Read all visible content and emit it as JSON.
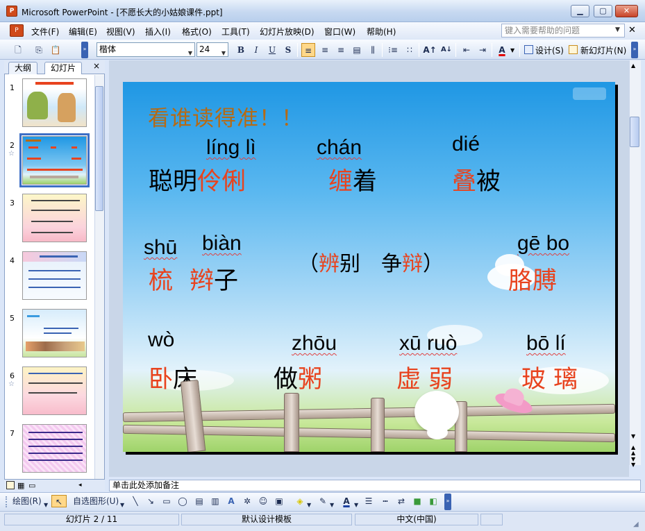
{
  "window": {
    "title": "Microsoft PowerPoint - [不愿长大的小姑娘课件.ppt]"
  },
  "menu": {
    "items": [
      "文件(F)",
      "编辑(E)",
      "视图(V)",
      "插入(I)",
      "格式(O)",
      "工具(T)",
      "幻灯片放映(D)",
      "窗口(W)",
      "帮助(H)"
    ],
    "help_placeholder": "键入需要帮助的问题"
  },
  "toolbar": {
    "font": "楷体",
    "size": "24",
    "bold": "B",
    "italic": "I",
    "underline": "U",
    "shadow": "S",
    "design_label": "设计(S)",
    "new_slide_label": "新幻灯片(N)"
  },
  "pane": {
    "tabs": [
      "大纲",
      "幻灯片"
    ],
    "close": "×",
    "thumbnails": [
      {
        "num": "1"
      },
      {
        "num": "2"
      },
      {
        "num": "3"
      },
      {
        "num": "4"
      },
      {
        "num": "5"
      },
      {
        "num": "6"
      },
      {
        "num": "7"
      }
    ]
  },
  "slide": {
    "title": "看谁读得准！！",
    "row1": [
      {
        "pinyin": "líng lì",
        "prefix": "聪明",
        "red": "伶俐",
        "suffix": ""
      },
      {
        "pinyin": "chán",
        "prefix": "",
        "red": "缠",
        "suffix": "着"
      },
      {
        "pinyin": "dié",
        "prefix": "",
        "red": "叠",
        "suffix": "被"
      }
    ],
    "row2": {
      "p1": "shū",
      "p2": "biàn",
      "w1": "梳",
      "w2red": "辫",
      "w2blk": "子",
      "paren_open": "（",
      "bian1": "辨",
      "bie": "别",
      "zheng": "争",
      "bian2": "辩",
      "paren_close": "）",
      "p3": "gē bo",
      "w3": "胳膊"
    },
    "row3": [
      {
        "pinyin": "wò",
        "red": "卧",
        "blk": "床",
        "red_first": true
      },
      {
        "pinyin": "zhōu",
        "blk": "做",
        "red": "粥",
        "red_first": false
      },
      {
        "pinyin": "xū ruò",
        "red": "虚 弱",
        "blk": "",
        "red_first": true
      },
      {
        "pinyin": "bō lí",
        "red": "玻 璃",
        "blk": "",
        "red_first": true
      }
    ]
  },
  "notes": {
    "placeholder": "单击此处添加备注"
  },
  "drawbar": {
    "draw_label": "绘图(R)",
    "autoshape_label": "自选图形(U)"
  },
  "status": {
    "slide": "幻灯片 2 / 11",
    "template": "默认设计模板",
    "language": "中文(中国)"
  }
}
